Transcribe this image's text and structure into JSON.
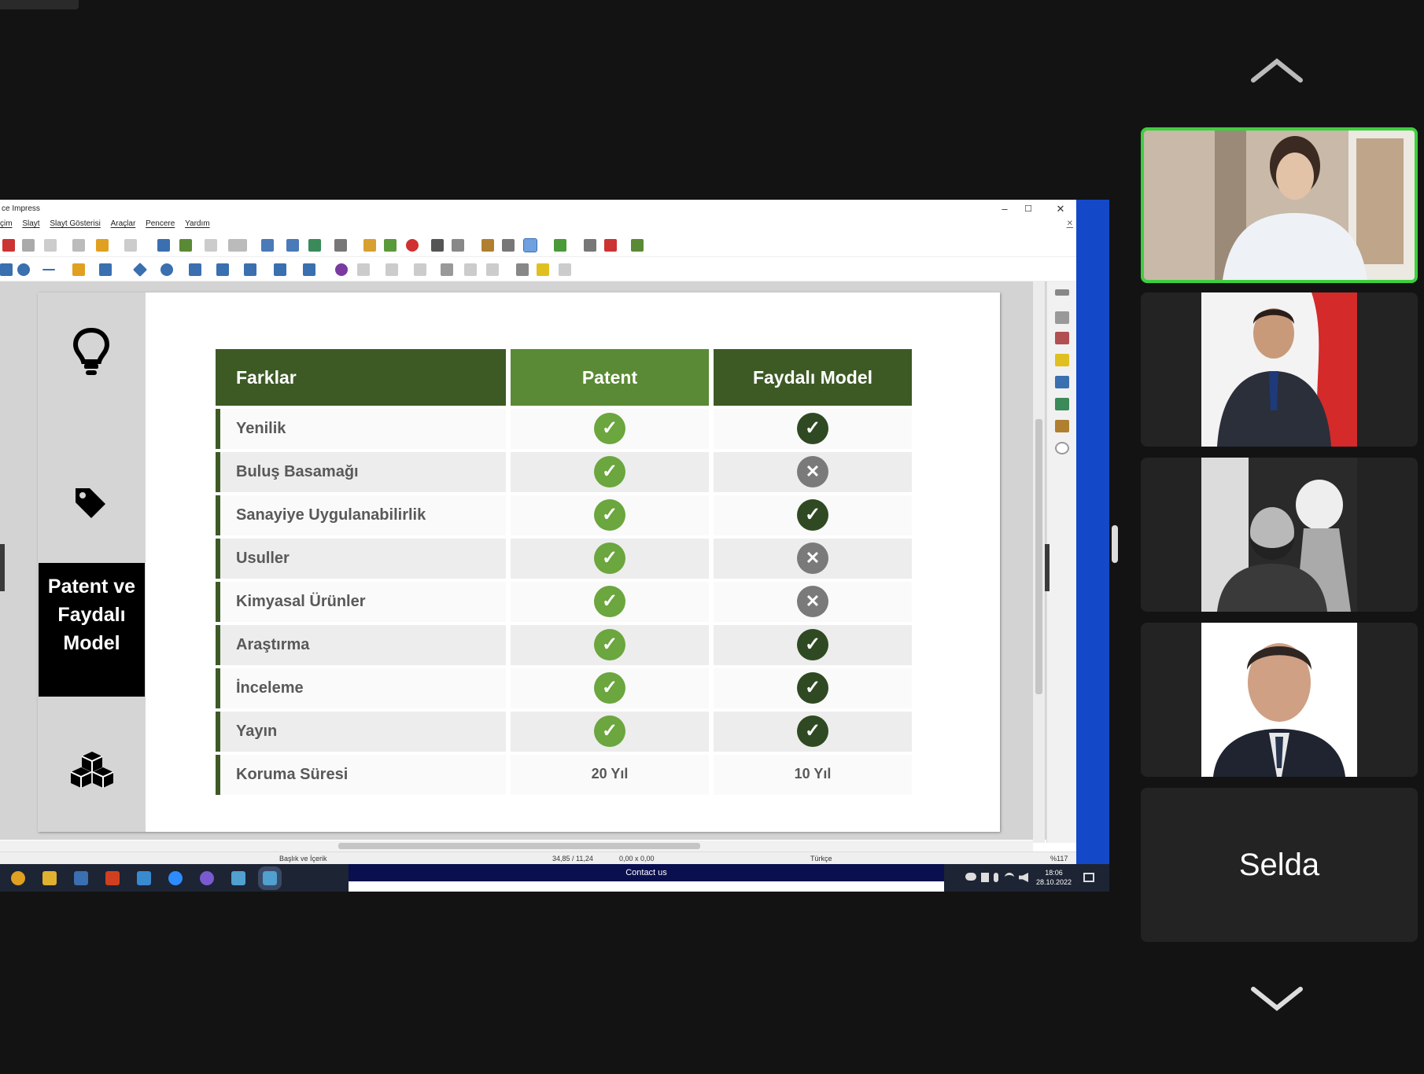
{
  "app": {
    "title": "ce Impress",
    "menu": [
      "çim",
      "Slayt",
      "Slayt Gösterisi",
      "Araçlar",
      "Pencere",
      "Yardım"
    ],
    "win_minimize": "–",
    "win_maximize": "☐",
    "win_close": "✕",
    "doc_close": "✕"
  },
  "slide": {
    "section_title": "Patent ve Faydalı Model",
    "headers": {
      "col1": "Farklar",
      "col2": "Patent",
      "col3": "Faydalı Model"
    },
    "rows": [
      {
        "label": "Yenilik",
        "patent": "yes",
        "faydali": "yes"
      },
      {
        "label": "Buluş Basamağı",
        "patent": "yes",
        "faydali": "no"
      },
      {
        "label": "Sanayiye Uygulanabilirlik",
        "patent": "yes",
        "faydali": "yes"
      },
      {
        "label": "Usuller",
        "patent": "yes",
        "faydali": "no"
      },
      {
        "label": "Kimyasal Ürünler",
        "patent": "yes",
        "faydali": "no"
      },
      {
        "label": "Araştırma",
        "patent": "yes",
        "faydali": "yes"
      },
      {
        "label": "İnceleme",
        "patent": "yes",
        "faydali": "yes"
      },
      {
        "label": "Yayın",
        "patent": "yes",
        "faydali": "yes"
      },
      {
        "label": "Koruma Süresi",
        "patent": "20 Yıl",
        "faydali": "10 Yıl"
      }
    ],
    "colors": {
      "header_dark": "#3d5a25",
      "header_light": "#5a8a35",
      "check_light": "#6ba63e",
      "check_dark": "#2f4a22",
      "cross": "#7a7a7a"
    }
  },
  "statusbar": {
    "layout": "Başlık ve İçerik",
    "position": "34,85 / 11,24",
    "size": "0,00 x 0,00",
    "language": "Türkçe",
    "zoom": "%117"
  },
  "taskbar": {
    "contact": "Contact us",
    "time": "18:06",
    "date": "28.10.2022"
  },
  "gallery": {
    "participant_name": "Selda",
    "active_speaker_color": "#3ecf3e"
  }
}
